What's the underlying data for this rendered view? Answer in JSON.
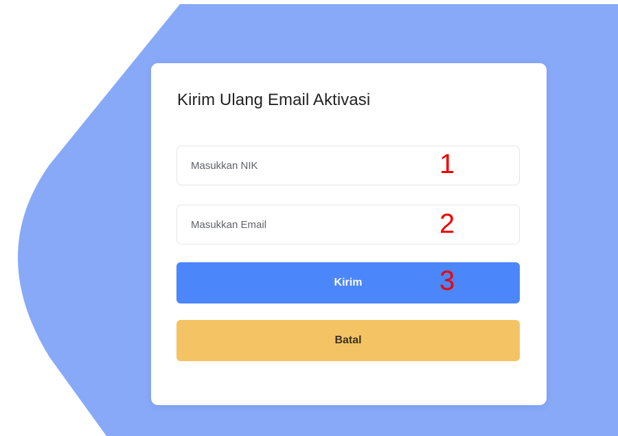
{
  "colors": {
    "background_shape": "#87a9f7",
    "primary_button": "#4b86fa",
    "cancel_button": "#f4c464",
    "annotation": "#f00000"
  },
  "form": {
    "title": "Kirim Ulang Email Aktivasi",
    "nik": {
      "placeholder": "Masukkan NIK",
      "value": ""
    },
    "email": {
      "placeholder": "Masukkan Email",
      "value": ""
    },
    "submit_label": "Kirim",
    "cancel_label": "Batal"
  },
  "annotations": [
    "1",
    "2",
    "3"
  ]
}
